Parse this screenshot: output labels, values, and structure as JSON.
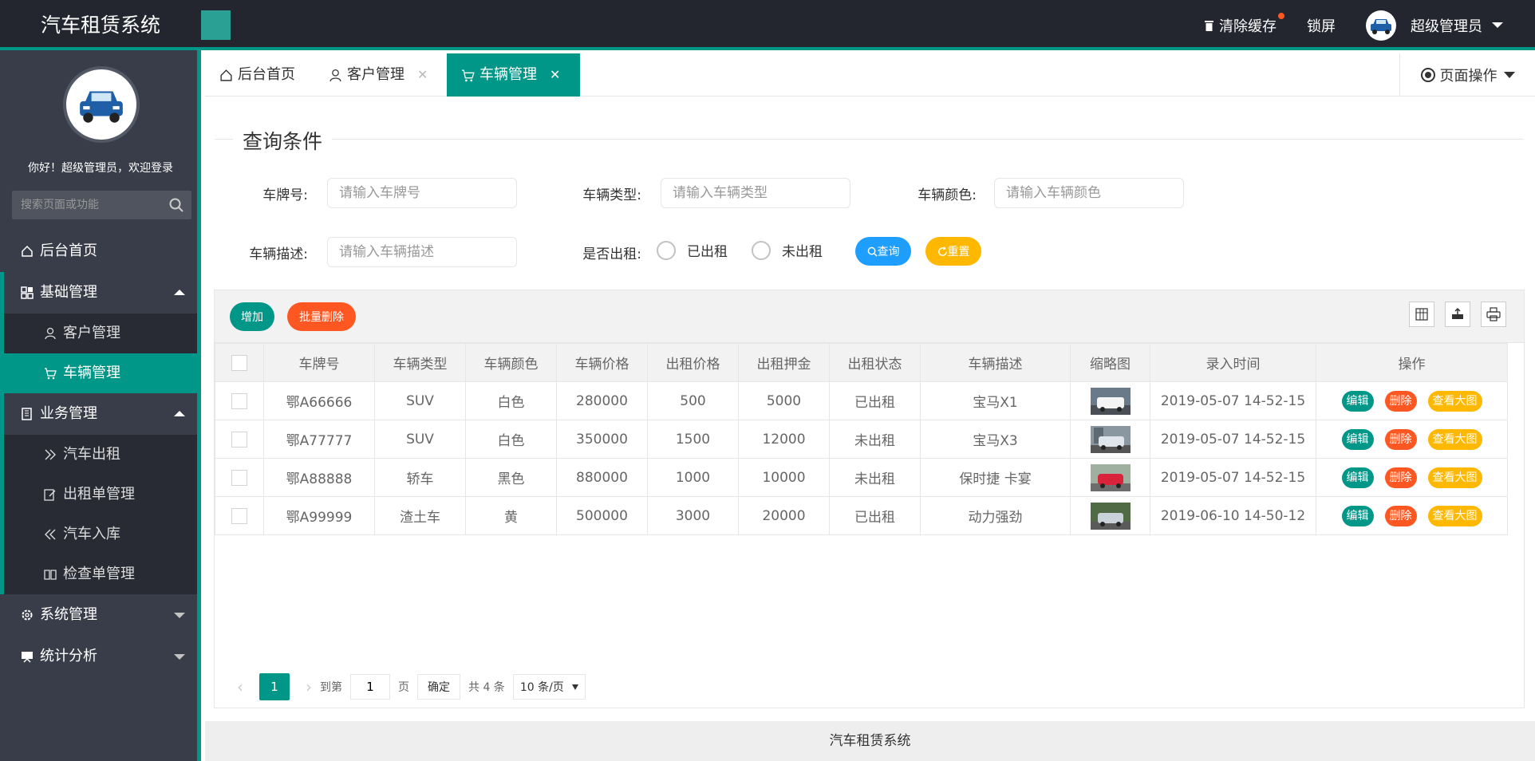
{
  "header": {
    "app_title": "汽车租赁系统",
    "clear_cache": "清除缓存",
    "lock_screen": "锁屏",
    "user_name": "超级管理员"
  },
  "sidebar": {
    "welcome": "你好！超级管理员，欢迎登录",
    "search_placeholder": "搜索页面或功能",
    "items": [
      {
        "label": "后台首页"
      },
      {
        "label": "基础管理",
        "children": [
          {
            "label": "客户管理"
          },
          {
            "label": "车辆管理"
          }
        ]
      },
      {
        "label": "业务管理",
        "children": [
          {
            "label": "汽车出租"
          },
          {
            "label": "出租单管理"
          },
          {
            "label": "汽车入库"
          },
          {
            "label": "检查单管理"
          }
        ]
      },
      {
        "label": "系统管理"
      },
      {
        "label": "统计分析"
      }
    ]
  },
  "tabs": [
    {
      "label": "后台首页"
    },
    {
      "label": "客户管理"
    },
    {
      "label": "车辆管理"
    }
  ],
  "page_ops": "页面操作",
  "query": {
    "title": "查询条件",
    "plate_label": "车牌号:",
    "plate_placeholder": "请输入车牌号",
    "type_label": "车辆类型:",
    "type_placeholder": "请输入车辆类型",
    "color_label": "车辆颜色:",
    "color_placeholder": "请输入车辆颜色",
    "desc_label": "车辆描述:",
    "desc_placeholder": "请输入车辆描述",
    "rented_label": "是否出租:",
    "opt_rented": "已出租",
    "opt_not_rented": "未出租",
    "search_btn": "查询",
    "reset_btn": "重置"
  },
  "toolbar": {
    "add": "增加",
    "batch_delete": "批量删除"
  },
  "table": {
    "columns": [
      "车牌号",
      "车辆类型",
      "车辆颜色",
      "车辆价格",
      "出租价格",
      "出租押金",
      "出租状态",
      "车辆描述",
      "缩略图",
      "录入时间",
      "操作"
    ],
    "rows": [
      {
        "plate": "鄂A66666",
        "type": "SUV",
        "color": "白色",
        "price": "280000",
        "rent": "500",
        "deposit": "5000",
        "status": "已出租",
        "desc": "宝马X1",
        "time": "2019-05-07 14-52-15"
      },
      {
        "plate": "鄂A77777",
        "type": "SUV",
        "color": "白色",
        "price": "350000",
        "rent": "1500",
        "deposit": "12000",
        "status": "未出租",
        "desc": "宝马X3",
        "time": "2019-05-07 14-52-15"
      },
      {
        "plate": "鄂A88888",
        "type": "轿车",
        "color": "黑色",
        "price": "880000",
        "rent": "1000",
        "deposit": "10000",
        "status": "未出租",
        "desc": "保时捷 卡宴",
        "time": "2019-05-07 14-52-15"
      },
      {
        "plate": "鄂A99999",
        "type": "渣土车",
        "color": "黄",
        "price": "500000",
        "rent": "3000",
        "deposit": "20000",
        "status": "已出租",
        "desc": "动力强劲",
        "time": "2019-06-10 14-50-12"
      }
    ],
    "row_actions": {
      "edit": "编辑",
      "delete": "删除",
      "view": "查看大图"
    }
  },
  "pager": {
    "current": "1",
    "goto": "到第",
    "page_input": "1",
    "page_unit": "页",
    "confirm": "确定",
    "total": "共 4 条",
    "page_size": "10 条/页"
  },
  "footer": "汽车租赁系统",
  "colors": {
    "accent": "#009688",
    "header_bg": "#23262e",
    "sidebar_bg": "#393d49",
    "danger": "#ff5722",
    "warm": "#ffb800",
    "info": "#1e9fff"
  }
}
